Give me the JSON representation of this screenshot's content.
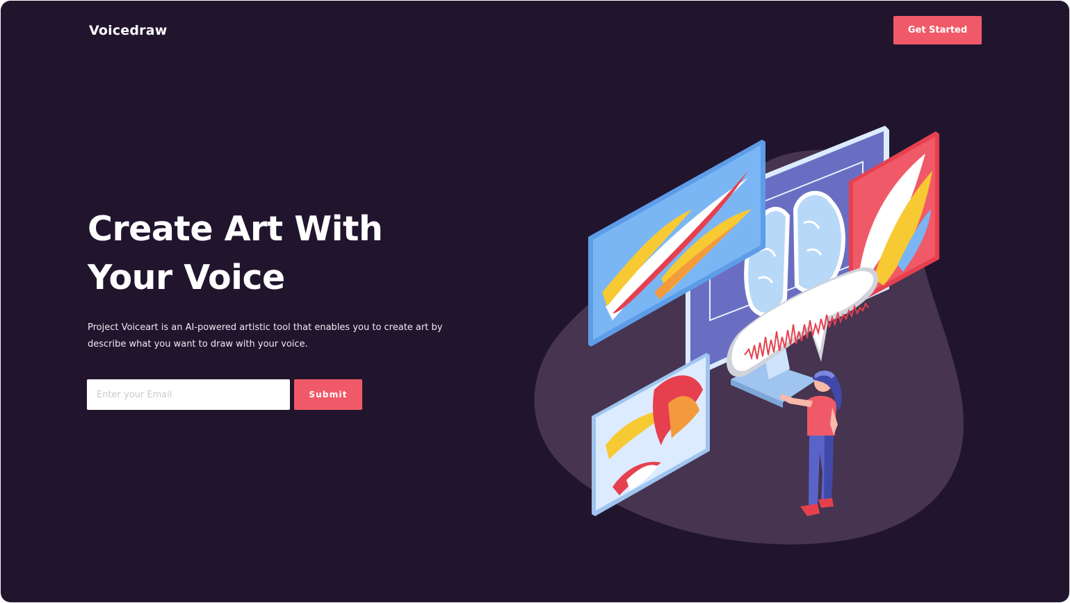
{
  "header": {
    "logo": "Voicedraw",
    "cta_label": "Get Started"
  },
  "hero": {
    "title_line1": "Create Art With",
    "title_line2": "Your Voice",
    "description_line1": "Project Voiceart is an AI-powered artistic tool that enables you to create art by",
    "description_line2": "describe what you want to draw with your voice."
  },
  "form": {
    "email_placeholder": "Enter your Email",
    "email_value": "",
    "submit_label": "Submit"
  },
  "colors": {
    "background": "#21152e",
    "accent": "#f05a68",
    "blob": "#463450"
  },
  "icons": {
    "illustration": "person-speaking-to-ai-art-screens-illustration"
  }
}
